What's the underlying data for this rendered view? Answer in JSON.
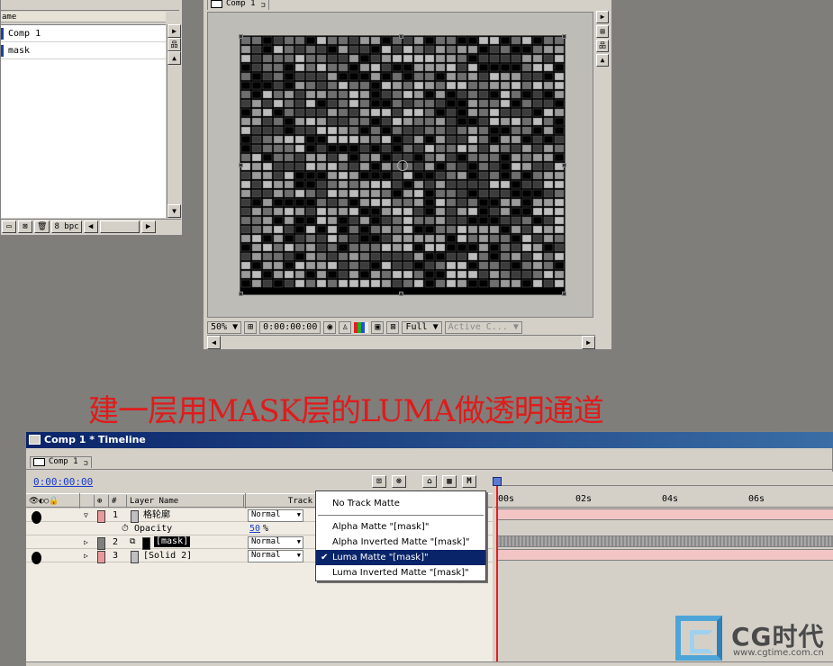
{
  "project": {
    "column_name": "ame",
    "items": [
      {
        "label": "Comp 1"
      },
      {
        "label": "mask"
      }
    ],
    "footer": {
      "bit_depth": "8 bpc"
    }
  },
  "comp_viewer": {
    "tab_label": "Comp 1",
    "zoom": "50%",
    "timecode": "0:00:00:00",
    "resolution": "Full",
    "view": "Active C..."
  },
  "caption": "建一层用MASK层的LUMA做透明通道",
  "timeline": {
    "title": "Comp 1 * Timeline",
    "tab_label": "Comp 1",
    "timecode": "0:00:00:00",
    "columns": {
      "number": "#",
      "layer_name": "Layer Name",
      "track": "Track"
    },
    "layers": [
      {
        "index": "1",
        "name": "格轮廓",
        "mode": "Normal",
        "color": "#e89a9a",
        "expanded": true
      },
      {
        "index": "",
        "name": "Opacity",
        "value": "50",
        "unit": "%"
      },
      {
        "index": "2",
        "name": "[mask]",
        "mode": "Normal",
        "color": "#808080"
      },
      {
        "index": "3",
        "name": "[Solid 2]",
        "mode": "Normal",
        "color": "#e89a9a"
      }
    ],
    "ruler_ticks": [
      "00s",
      "02s",
      "04s",
      "06s"
    ],
    "track_matte_menu": {
      "items": [
        "No Track Matte",
        "Alpha Matte \"[mask]\"",
        "Alpha Inverted Matte \"[mask]\"",
        "Luma Matte \"[mask]\"",
        "Luma Inverted Matte \"[mask]\""
      ],
      "selected": "Luma Matte \"[mask]\""
    }
  },
  "watermark": {
    "brand": "CG时代",
    "url": "www.cgtime.com.cn"
  },
  "colors": {
    "accent": "#0a246a",
    "caption": "#e01b1b",
    "bar_pink": "#f2c4c4"
  }
}
